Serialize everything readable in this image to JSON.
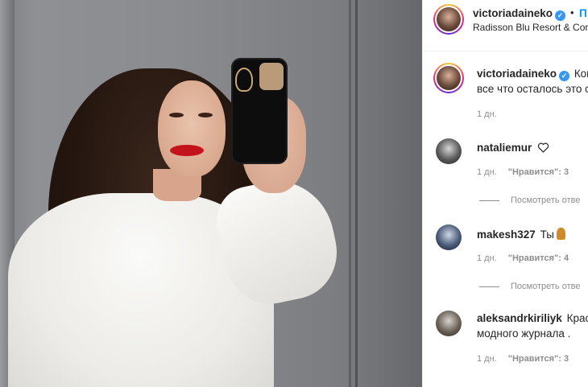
{
  "post": {
    "author": "victoriadaineko",
    "follow_label": "П",
    "dot": "•",
    "location": "Radisson Blu Resort & Cor"
  },
  "caption": {
    "username": "victoriadaineko",
    "text_line1": "Ког",
    "text_line2": "все что осталось это с",
    "time": "1 дн."
  },
  "comments": [
    {
      "username": "nataliemur",
      "text": "",
      "icon": "heart-outline",
      "time": "1 дн.",
      "likes": "\"Нравится\": 3",
      "replies": "Посмотреть отве"
    },
    {
      "username": "makesh327",
      "text": "Ты",
      "icon": "person-emoji",
      "time": "1 дн.",
      "likes": "\"Нравится\": 4",
      "replies": "Посмотреть отве"
    },
    {
      "username": "aleksandrkiriliyk",
      "text": "Крас",
      "text_line2": "модного журнала .",
      "time": "1 дн.",
      "likes": "\"Нравится\": 3"
    }
  ],
  "colors": {
    "accent": "#0095f6",
    "verified": "#3897f0",
    "muted": "#8e8e8e",
    "lips": "#c3141e"
  }
}
